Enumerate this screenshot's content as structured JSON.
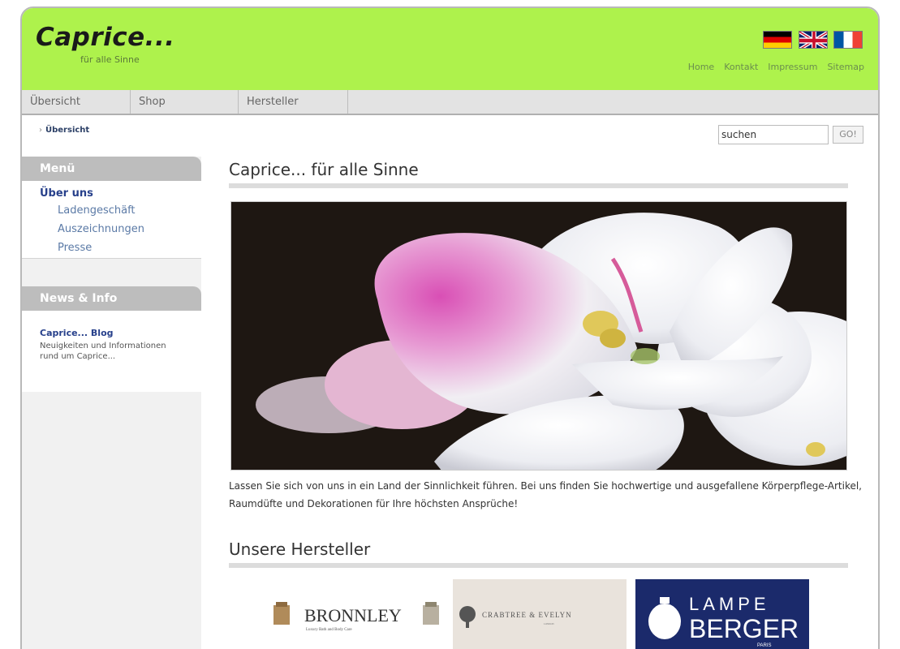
{
  "header": {
    "title": "Caprice...",
    "subtitle": "für alle Sinne",
    "background": "#aef24c",
    "flags": [
      "flag-germany-icon",
      "flag-uk-icon",
      "flag-france-icon"
    ],
    "links": [
      "Home",
      "Kontakt",
      "Impressum",
      "Sitemap"
    ]
  },
  "nav": {
    "tabs": [
      "Übersicht",
      "Shop",
      "Hersteller"
    ]
  },
  "breadcrumb": {
    "current": "Übersicht"
  },
  "search": {
    "value": "suchen",
    "button": "GO!"
  },
  "sidebar": {
    "menu_heading": "Menü",
    "menu_main": "Über uns",
    "menu_items": [
      "Ladengeschäft",
      "Auszeichnungen",
      "Presse"
    ],
    "news_heading": "News & Info",
    "blog_title": "Caprice... Blog",
    "blog_text": "Neuigkeiten und Informationen rund um Caprice..."
  },
  "main": {
    "title": "Caprice... für alle Sinne",
    "hero_image": "white-pink-orchid-photo",
    "intro": "Lassen Sie sich von uns in ein Land der Sinnlichkeit führen. Bei uns finden Sie hochwertige und ausgefallene Körperpflege-Artikel, Raumdüfte und Dekorationen für Ihre höchsten Ansprüche!",
    "brands_title": "Unsere Hersteller",
    "brands": [
      {
        "name": "BRONNLEY",
        "tagline": "Luxury Bath and Body Care"
      },
      {
        "name": "CRABTREE & EVELYN",
        "tagline": "LONDON"
      },
      {
        "name": "LAMPE",
        "name2": "BERGER",
        "tagline": "PARIS"
      }
    ]
  }
}
